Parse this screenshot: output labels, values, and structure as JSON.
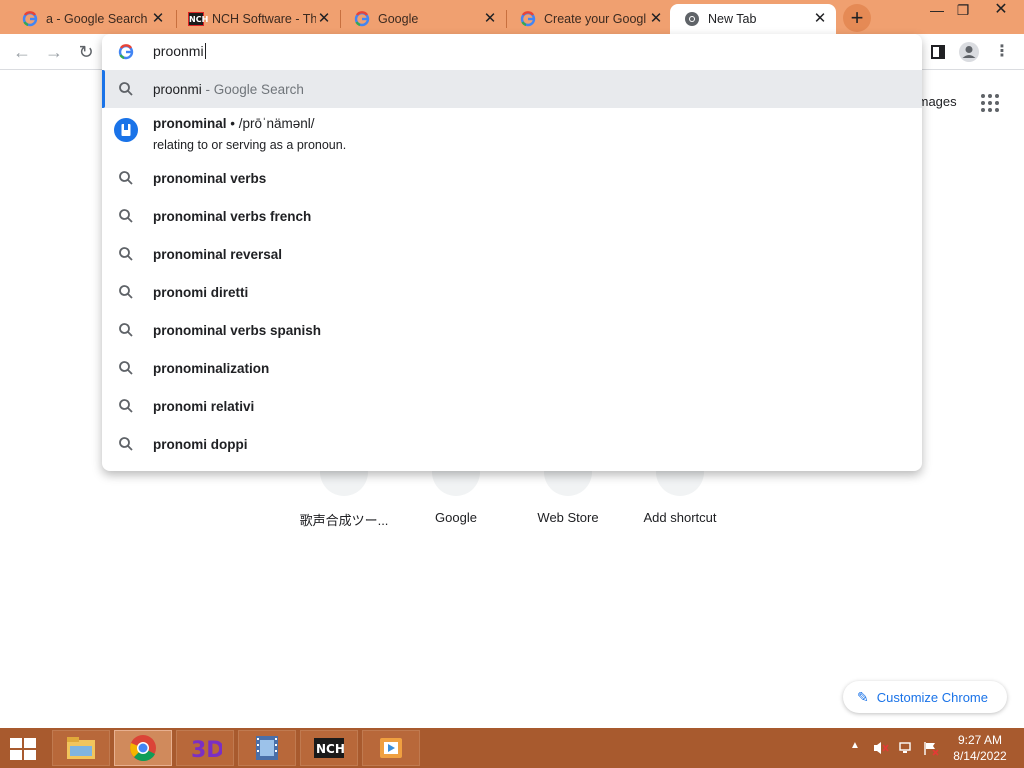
{
  "browser": {
    "tabs": [
      {
        "title": "a - Google Search",
        "icon": "google-icon",
        "active": false
      },
      {
        "title": "NCH Software - Th",
        "icon": "nch-icon",
        "active": false
      },
      {
        "title": "Google",
        "icon": "google-icon",
        "active": false
      },
      {
        "title": "Create your Googl",
        "icon": "google-icon",
        "active": false
      },
      {
        "title": "New Tab",
        "icon": "chrome-icon",
        "active": true
      }
    ],
    "new_tab_label": "+"
  },
  "omnibox": {
    "input_value": "proonmi",
    "suggestions": [
      {
        "query": "proonmi",
        "suffix": " - Google Search",
        "type": "search",
        "highlighted": true
      },
      {
        "type": "dictionary",
        "word": "pronominal",
        "pronunciation": " • /prōˈnämənl/",
        "definition": "relating to or serving as a pronoun."
      },
      {
        "query": "pronominal verbs",
        "type": "search"
      },
      {
        "query": "pronominal verbs french",
        "type": "search"
      },
      {
        "query": "pronominal reversal",
        "type": "search"
      },
      {
        "query": "pronomi diretti",
        "type": "search"
      },
      {
        "query": "pronominal verbs spanish",
        "type": "search"
      },
      {
        "query": "pronominalization",
        "type": "search"
      },
      {
        "query": "pronomi relativi",
        "type": "search"
      },
      {
        "query": "pronomi doppi",
        "type": "search"
      }
    ]
  },
  "ntp": {
    "top_links": {
      "images": "Images"
    },
    "shortcuts": [
      {
        "label": "歌声合成ツー..."
      },
      {
        "label": "Google"
      },
      {
        "label": "Web Store"
      },
      {
        "label": "Add shortcut"
      }
    ],
    "customize_label": "Customize Chrome"
  },
  "taskbar": {
    "apps": [
      "file-explorer-icon",
      "chrome-icon",
      "3d-app-icon",
      "video-film-icon",
      "nch-software-icon",
      "media-player-icon"
    ],
    "clock": {
      "time": "9:27 AM",
      "date": "8/14/2022"
    }
  },
  "colors": {
    "tabstrip": "#f0a070",
    "taskbar": "#a85a2e",
    "accent": "#1a73e8"
  }
}
